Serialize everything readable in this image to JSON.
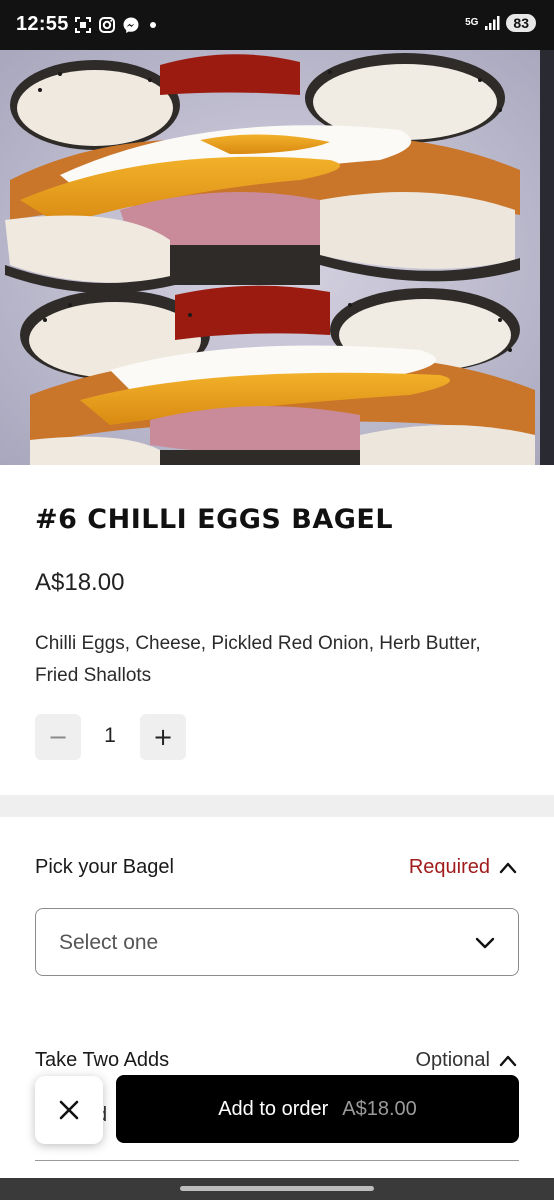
{
  "status_bar": {
    "time": "12:55",
    "network": "5G",
    "battery": "83",
    "icons": [
      "screenshot-icon",
      "instagram-icon",
      "messenger-icon",
      "notification-dot"
    ]
  },
  "product": {
    "image": "bagel-photo",
    "title": "#6 CHILLI EGGS BAGEL",
    "price": "A$18.00",
    "description": "Chilli Eggs, Cheese, Pickled Red Onion, Herb Butter, Fried Shallots"
  },
  "quantity": {
    "value": "1",
    "minus_label": "−",
    "plus_label": "+"
  },
  "options": [
    {
      "label": "Pick your Bagel",
      "status": "Required",
      "placeholder": "Select one"
    },
    {
      "label": "Take Two Adds",
      "status": "Optional",
      "partial_item": "d"
    }
  ],
  "footer": {
    "close_label": "×",
    "add_label": "Add to order",
    "add_price": "A$18.00"
  },
  "colors": {
    "required": "#a01c1c",
    "button_bg": "#000000",
    "separator": "#efefef"
  }
}
